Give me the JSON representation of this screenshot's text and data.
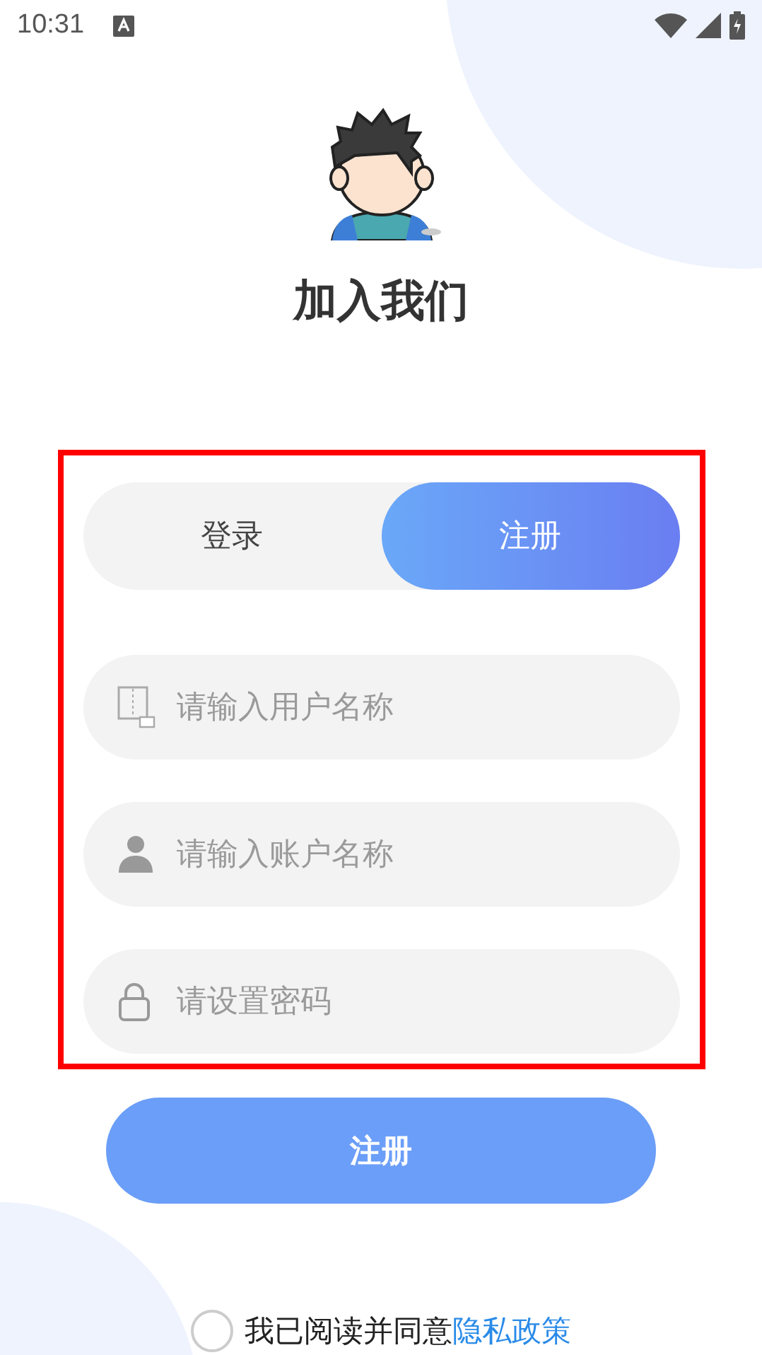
{
  "status_bar": {
    "time": "10:31"
  },
  "title": "加入我们",
  "tabs": [
    {
      "label": "登录",
      "selected": false
    },
    {
      "label": "注册",
      "selected": true
    }
  ],
  "fields": [
    {
      "kind": "name",
      "placeholder": "请输入用户名称"
    },
    {
      "kind": "user",
      "placeholder": "请输入账户名称"
    },
    {
      "kind": "lock",
      "placeholder": "请设置密码"
    }
  ],
  "submit_button": "注册",
  "agreement": {
    "checked": false,
    "text": "我已阅读并同意",
    "link": "隐私政策"
  }
}
